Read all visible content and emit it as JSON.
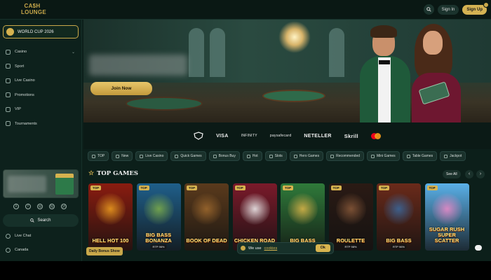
{
  "header": {
    "logo_line1": "CA$H",
    "logo_line2": "LOUNGE",
    "signin_label": "Sign In",
    "signup_label": "Sign Up"
  },
  "sidebar": {
    "worldcup_label": "WORLD CUP 2026",
    "items": [
      {
        "label": "Casino",
        "icon": "cards-icon"
      },
      {
        "label": "Sport",
        "icon": "ball-icon"
      },
      {
        "label": "Live Casino",
        "icon": "live-icon"
      },
      {
        "label": "Promotions",
        "icon": "gift-icon"
      },
      {
        "label": "VIP",
        "icon": "crown-icon"
      },
      {
        "label": "Tournaments",
        "icon": "trophy-icon"
      }
    ],
    "search_label": "Search",
    "live_chat_label": "Live Chat",
    "country_label": "Canada",
    "socials": [
      "X",
      "f",
      "ig",
      "tg",
      "yt"
    ]
  },
  "hero": {
    "join_label": "Join Now"
  },
  "payments": [
    "VISA",
    "INFINITY",
    "paysafecard",
    "NETELLER",
    "Skrill"
  ],
  "chips": [
    "TOP",
    "New",
    "Live Casino",
    "Quick Games",
    "Bonus Buy",
    "Hot",
    "Slots",
    "Hero Games",
    "Recommended",
    "Mini Games",
    "Table Games",
    "Jackpot"
  ],
  "top_games": {
    "title": "TOP GAMES",
    "see_all_label": "See All",
    "daily_bonus_label": "Daily Bonus Show",
    "top_badge": "TOP",
    "games": [
      {
        "title": "HELL HOT 100",
        "rtp": "",
        "color": "#8a1c10",
        "art": "#f0a020"
      },
      {
        "title": "BIG BASS BONANZA",
        "rtp": "RTP 96%",
        "color": "#1f5f8a",
        "art": "#7fb04a"
      },
      {
        "title": "BOOK OF DEAD",
        "rtp": "",
        "color": "#5a3a1c",
        "art": "#a06a2e"
      },
      {
        "title": "CHICKEN ROAD",
        "rtp": "",
        "color": "#7a1a2a",
        "art": "#f5f5f5"
      },
      {
        "title": "BIG BASS",
        "rtp": "RTP 96%",
        "color": "#2f7a3a",
        "art": "#e0b84a"
      },
      {
        "title": "ROULETTE",
        "rtp": "RTP 98%",
        "color": "#2a1a14",
        "art": "#8a5a3a"
      },
      {
        "title": "BIG BASS",
        "rtp": "RTP 96%",
        "color": "#6a2a1a",
        "art": "#3a6aa0"
      },
      {
        "title": "SUGAR RUSH SUPER SCATTER",
        "rtp": "",
        "color": "#5ab0e8",
        "art": "#f08ac8"
      }
    ]
  },
  "cookie": {
    "text": "We use",
    "link": "cookies",
    "ok_label": "Ok"
  },
  "colors": {
    "accent_gold": "#d8b44f",
    "background": "#0c1f1a"
  }
}
